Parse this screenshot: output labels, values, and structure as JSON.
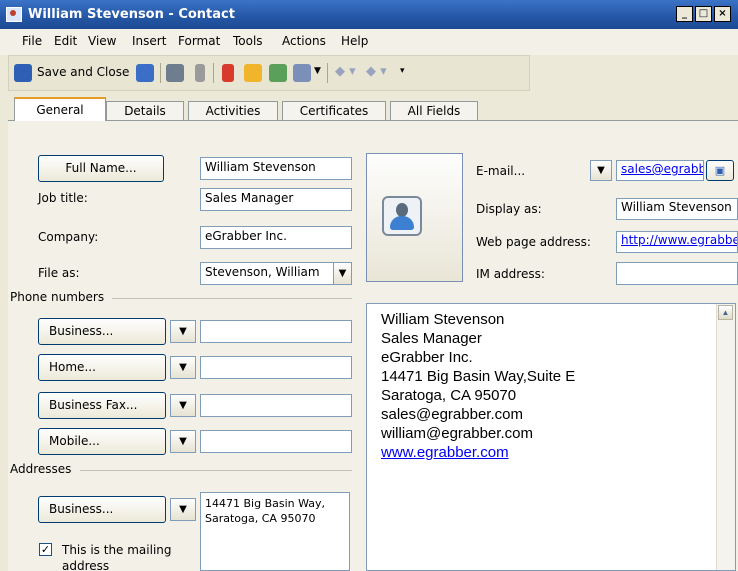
{
  "window": {
    "title": "William Stevenson - Contact"
  },
  "menu": [
    "File",
    "Edit",
    "View",
    "Insert",
    "Format",
    "Tools",
    "Actions",
    "Help"
  ],
  "toolbar": {
    "save_close": "Save and Close"
  },
  "tabs": [
    "General",
    "Details",
    "Activities",
    "Certificates",
    "All Fields"
  ],
  "form": {
    "full_name_button": "Full Name...",
    "full_name_value": "William Stevenson",
    "job_title_label": "Job title:",
    "job_title_value": "Sales Manager",
    "company_label": "Company:",
    "company_value": "eGrabber Inc.",
    "file_as_label": "File as:",
    "file_as_value": "Stevenson, William",
    "phone_group": "Phone numbers",
    "phones": [
      "Business...",
      "Home...",
      "Business Fax...",
      "Mobile..."
    ],
    "addresses_group": "Addresses",
    "address_button": "Business...",
    "address_lines": [
      "14471 Big Basin Way,",
      "Saratoga, CA  95070"
    ],
    "mailing_label_1": "This is the mailing",
    "mailing_label_2": "address",
    "email_button": "E-mail...",
    "email_value": "sales@egrabber.com",
    "display_as_label": "Display as:",
    "display_as_value": "William Stevenson",
    "web_label": "Web page address:",
    "web_value": "http://www.egrabber.com",
    "im_label": "IM address:",
    "im_value": ""
  },
  "notes": [
    "William Stevenson",
    "Sales Manager",
    "eGrabber Inc.",
    "14471 Big Basin Way,Suite E",
    "Saratoga, CA 95070",
    "sales@egrabber.com",
    "william@egrabber.com",
    "www.egrabber.com"
  ],
  "colors": {
    "titlebar": "#2456a5",
    "active_tab_accent": "#e69b24",
    "link": "#0000ee"
  }
}
